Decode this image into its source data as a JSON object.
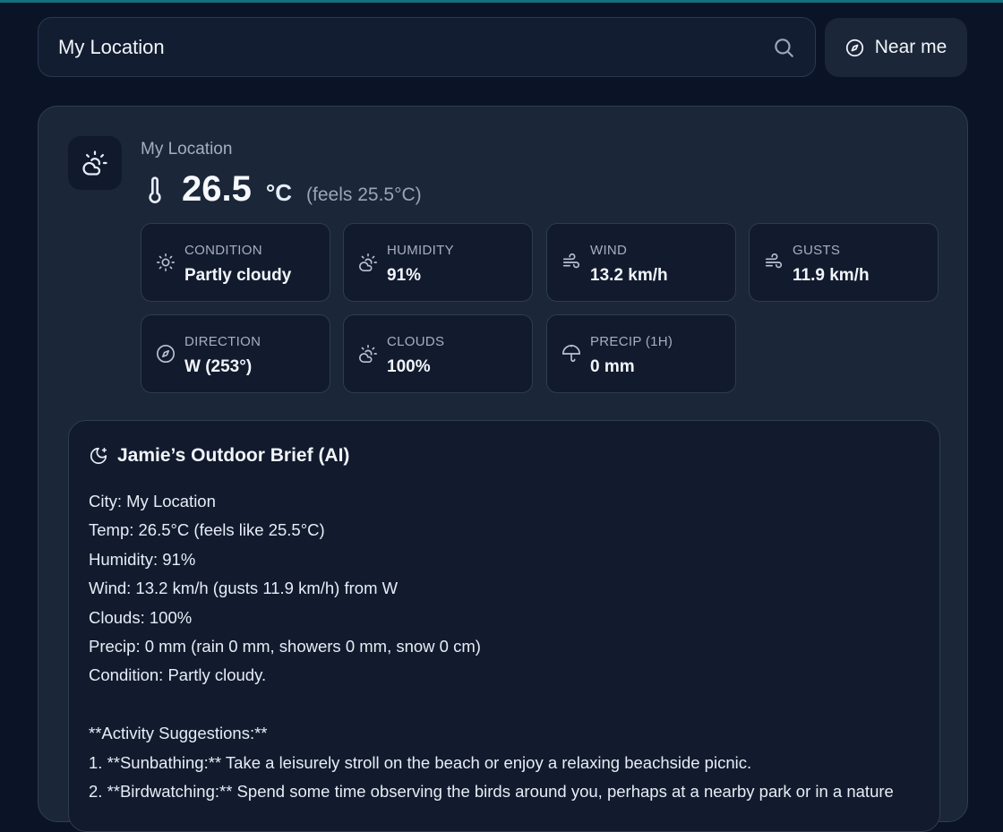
{
  "search": {
    "value": "My Location"
  },
  "near_button": {
    "label": "Near me"
  },
  "current": {
    "location": "My Location",
    "temperature": "26.5",
    "unit": "°C",
    "feels": "(feels 25.5°C)"
  },
  "tiles": [
    {
      "label": "CONDITION",
      "value": "Partly cloudy",
      "icon": "sun-icon"
    },
    {
      "label": "HUMIDITY",
      "value": "91%",
      "icon": "cloud-sun-icon"
    },
    {
      "label": "WIND",
      "value": "13.2 km/h",
      "icon": "wind-icon"
    },
    {
      "label": "GUSTS",
      "value": "11.9 km/h",
      "icon": "wind-icon"
    },
    {
      "label": "DIRECTION",
      "value": "W (253°)",
      "icon": "compass-icon"
    },
    {
      "label": "CLOUDS",
      "value": "100%",
      "icon": "cloud-sun-icon"
    },
    {
      "label": "PRECIP (1H)",
      "value": "0 mm",
      "icon": "umbrella-icon"
    }
  ],
  "brief": {
    "title": "Jamie’s Outdoor Brief (AI)",
    "lines": [
      "City: My Location",
      "Temp: 26.5°C (feels like 25.5°C)",
      "Humidity: 91%",
      "Wind: 13.2 km/h (gusts 11.9 km/h) from W",
      "Clouds: 100%",
      "Precip: 0 mm (rain 0 mm, showers 0 mm, snow 0 cm)",
      "Condition: Partly cloudy.",
      "",
      "**Activity Suggestions:**",
      "1. **Sunbathing:** Take a leisurely stroll on the beach or enjoy a relaxing beachside picnic.",
      "2. **Birdwatching:** Spend some time observing the birds around you, perhaps at a nearby park or in a nature"
    ]
  }
}
